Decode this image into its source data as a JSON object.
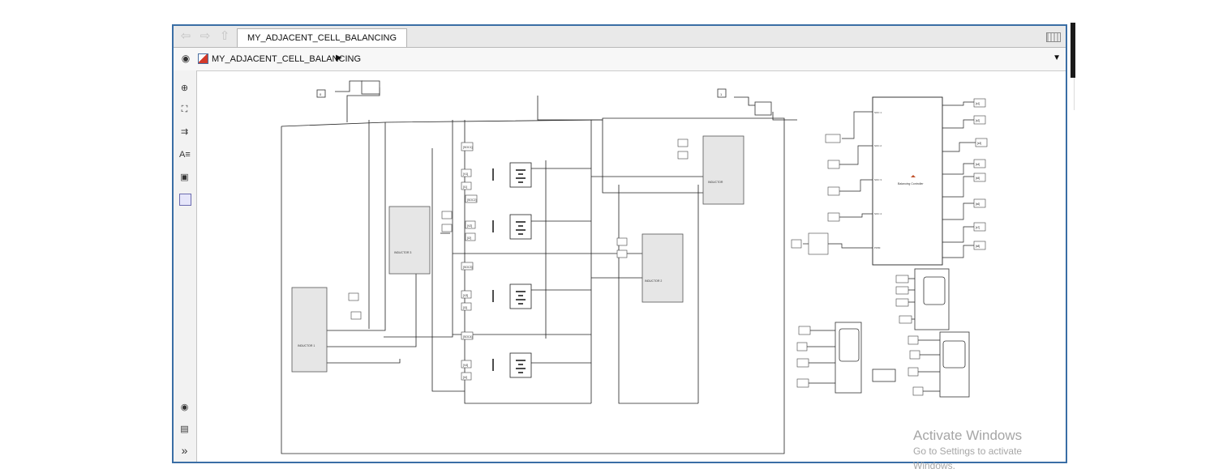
{
  "tab": {
    "title": "MY_ADJACENT_CELL_BALANCING"
  },
  "address": {
    "path": "MY_ADJACENT_CELL_BALANCING"
  },
  "watermark": {
    "title": "Activate Windows",
    "subtitle": "Go to Settings to activate Windows."
  },
  "diagram": {
    "const_a": "0",
    "const_b": "1",
    "cell_blocks": [
      "[SOC1]",
      "[SOC2]",
      "[SOC3]",
      "[SOC4]"
    ],
    "voltage_tags": [
      "[V1]",
      "[V2]",
      "[V3]",
      "[V4]"
    ],
    "current_tags": [
      "[I1]",
      "[I2]",
      "[I3]",
      "[I4]"
    ],
    "inductor_labels": [
      "INDUCTOR",
      "INDUCTOR 1",
      "INDUCTOR 2",
      "INDUCTOR 3"
    ],
    "controller_label": "Balancing Controller",
    "controller_inputs": [
      "SOC 1",
      "SOC 2",
      "SOC 3",
      "SOC 4",
      "PWM"
    ],
    "controller_outputs": [
      "[s1]",
      "[s2]",
      "[s3]",
      "[s4]",
      "[s5]",
      "[s6]",
      "[s7]",
      "[s8]"
    ]
  }
}
